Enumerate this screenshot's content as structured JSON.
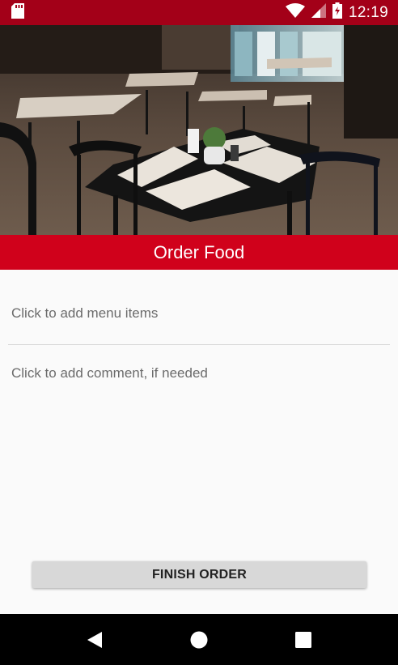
{
  "status_bar": {
    "time": "12:19",
    "icons": [
      "sd-card-icon",
      "wifi-icon",
      "cell-signal-icon",
      "battery-icon"
    ],
    "color": "#a30018"
  },
  "hero": {
    "icon": "restaurant-photo"
  },
  "header": {
    "title": "Order Food",
    "color": "#d0011b"
  },
  "form": {
    "menu_items_prompt": "Click to add menu items",
    "comment_prompt": "Click to add comment, if needed"
  },
  "actions": {
    "finish_label": "FINISH ORDER"
  },
  "nav_bar": {
    "icons": [
      "back-icon",
      "home-icon",
      "recents-icon"
    ]
  }
}
